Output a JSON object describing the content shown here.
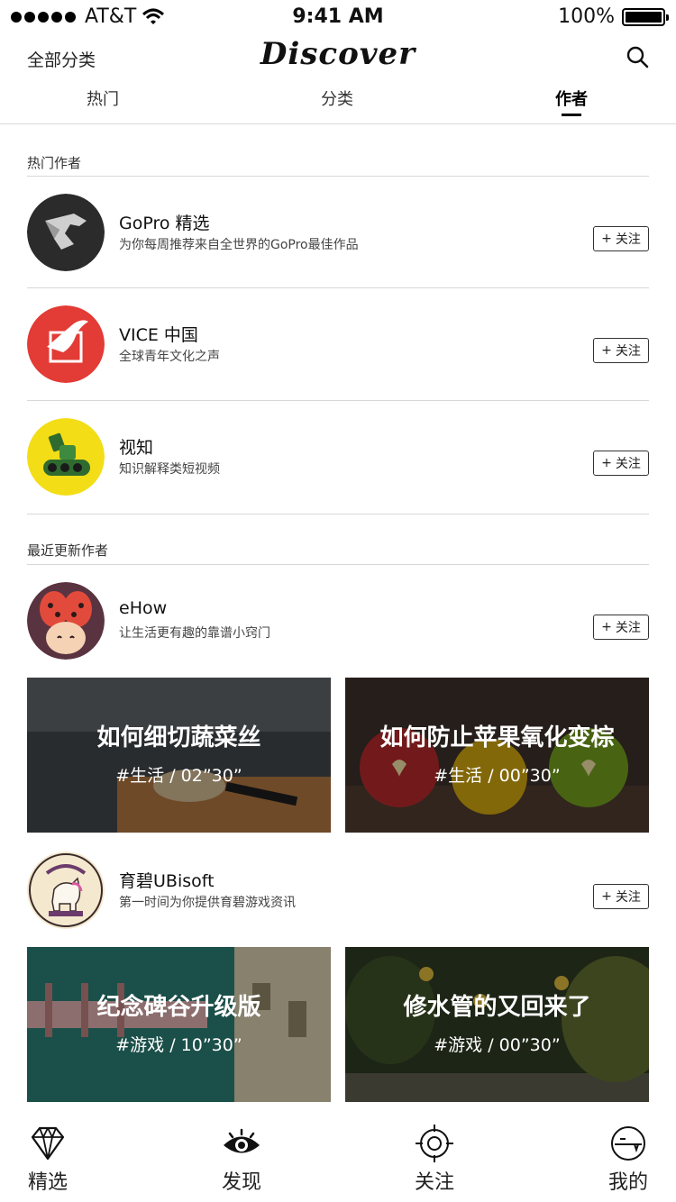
{
  "status_bar": {
    "carrier": "AT&T",
    "time": "9:41 AM",
    "battery": "100%"
  },
  "header": {
    "left_label": "全部分类",
    "title": "Discover"
  },
  "tabs": [
    {
      "label": "热门"
    },
    {
      "label": "分类"
    },
    {
      "label": "作者"
    }
  ],
  "sections": {
    "hot": "热门作者",
    "recent": "最近更新作者"
  },
  "follow_label": "关注",
  "hot_authors": [
    {
      "name": "GoPro 精选",
      "desc": "为你每周推荐来自全世界的GoPro最佳作品"
    },
    {
      "name": "VICE 中国",
      "desc": "全球青年文化之声"
    },
    {
      "name": "视知",
      "desc": "知识解释类短视频"
    }
  ],
  "recent_authors": [
    {
      "name": "eHow",
      "desc": "让生活更有趣的靠谱小窍门",
      "videos": [
        {
          "title": "如何细切蔬菜丝",
          "meta": "#生活 / 02”30”"
        },
        {
          "title": "如何防止苹果氧化变棕",
          "meta": "#生活 / 00”30”"
        }
      ]
    },
    {
      "name": "育碧UBisoft",
      "desc": "第一时间为你提供育碧游戏资讯",
      "videos": [
        {
          "title": "纪念碑谷升级版",
          "meta": "#游戏 / 10”30”"
        },
        {
          "title": "修水管的又回来了",
          "meta": "#游戏 / 00”30”"
        }
      ]
    }
  ],
  "tabbar": [
    {
      "label": "精选",
      "icon": "diamond-icon"
    },
    {
      "label": "发现",
      "icon": "eye-icon"
    },
    {
      "label": "关注",
      "icon": "target-icon"
    },
    {
      "label": "我的",
      "icon": "profile-icon"
    }
  ]
}
